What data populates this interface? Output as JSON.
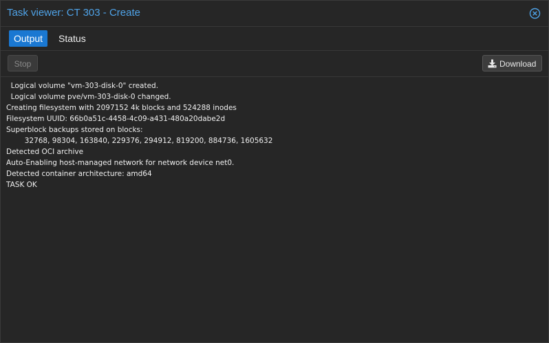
{
  "window": {
    "title": "Task viewer: CT 303 - Create",
    "close_icon": "close-circle-icon"
  },
  "tabs": [
    {
      "label": "Output",
      "active": true
    },
    {
      "label": "Status",
      "active": false
    }
  ],
  "toolbar": {
    "stop_label": "Stop",
    "download_label": "Download",
    "download_icon": "download-icon"
  },
  "log": {
    "lines": [
      "  Logical volume \"vm-303-disk-0\" created.",
      "  Logical volume pve/vm-303-disk-0 changed.",
      "Creating filesystem with 2097152 4k blocks and 524288 inodes",
      "Filesystem UUID: 66b0a51c-4458-4c09-a431-480a20dabe2d",
      "Superblock backups stored on blocks:",
      "\t32768, 98304, 163840, 229376, 294912, 819200, 884736, 1605632",
      "Detected OCI archive",
      "Auto-Enabling host-managed network for network device net0.",
      "Detected container architecture: amd64",
      "TASK OK"
    ]
  },
  "colors": {
    "accent": "#1a78d2",
    "title": "#4fa3e8",
    "background": "#242424"
  }
}
